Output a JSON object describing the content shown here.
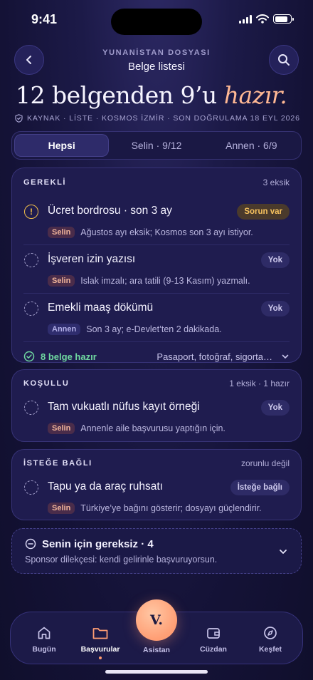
{
  "status_bar": {
    "time": "9:41"
  },
  "header": {
    "eyebrow": "YUNANİSTAN DOSYASI",
    "title": "Belge listesi"
  },
  "hero": {
    "title_main": "12 belgenden 9’u ",
    "title_accent": "hazır.",
    "source_line": "KAYNAK · LİSTE · KOSMOS İZMİR · SON DOĞRULAMA 18 EYL 2026"
  },
  "segments": [
    {
      "label": "Hepsi",
      "active": true
    },
    {
      "label": "Selin · 9/12",
      "active": false
    },
    {
      "label": "Annen · 6/9",
      "active": false
    }
  ],
  "required": {
    "label": "GEREKLİ",
    "meta": "3 eksik",
    "items": [
      {
        "title": "Ücret bordrosu · son 3 ay",
        "person": "Selin",
        "note": "Ağustos ayı eksik; Kosmos son 3 ayı istiyor.",
        "badge": "Sorun var",
        "status": "warning"
      },
      {
        "title": "İşveren izin yazısı",
        "person": "Selin",
        "note": "Islak imzalı; ara tatili (9-13 Kasım) yazmalı.",
        "badge": "Yok",
        "status": "missing"
      },
      {
        "title": "Emekli maaş dökümü",
        "person": "Annen",
        "note": "Son 3 ay; e-Devlet’ten 2 dakikada.",
        "badge": "Yok",
        "status": "missing"
      }
    ],
    "ready": {
      "label": "8 belge hazır",
      "list": "Pasaport, fotoğraf, sigorta…"
    }
  },
  "conditional": {
    "label": "KOŞULLU",
    "meta": "1 eksik · 1 hazır",
    "items": [
      {
        "title": "Tam vukuatlı nüfus kayıt örneği",
        "person": "Selin",
        "note": "Annenle aile başvurusu yaptığın için.",
        "badge": "Yok",
        "status": "missing"
      }
    ]
  },
  "optional": {
    "label": "İSTEĞE BAĞLI",
    "meta": "zorunlu değil",
    "items": [
      {
        "title": "Tapu ya da araç ruhsatı",
        "person": "Selin",
        "note": "Türkiye’ye bağını gösterir; dosyayı güçlendirir.",
        "badge": "İsteğe bağlı",
        "status": "optional"
      }
    ]
  },
  "not_needed": {
    "title": "Senin için gereksiz · 4",
    "subtitle": "Sponsor dilekçesi: kendi gelirinle başvuruyorsun."
  },
  "tabbar": {
    "tabs": [
      {
        "label": "Bugün",
        "icon": "home-icon"
      },
      {
        "label": "Başvurular",
        "icon": "folder-icon",
        "active": true
      },
      {
        "label": "Cüzdan",
        "icon": "wallet-icon"
      },
      {
        "label": "Keşfet",
        "icon": "compass-icon"
      }
    ],
    "assistant": {
      "label": "Asistan",
      "letter": "V."
    }
  },
  "colors": {
    "accent": "#ffb894",
    "warning": "#f2bf4a",
    "success": "#6fd8a0",
    "background": "#161440"
  }
}
